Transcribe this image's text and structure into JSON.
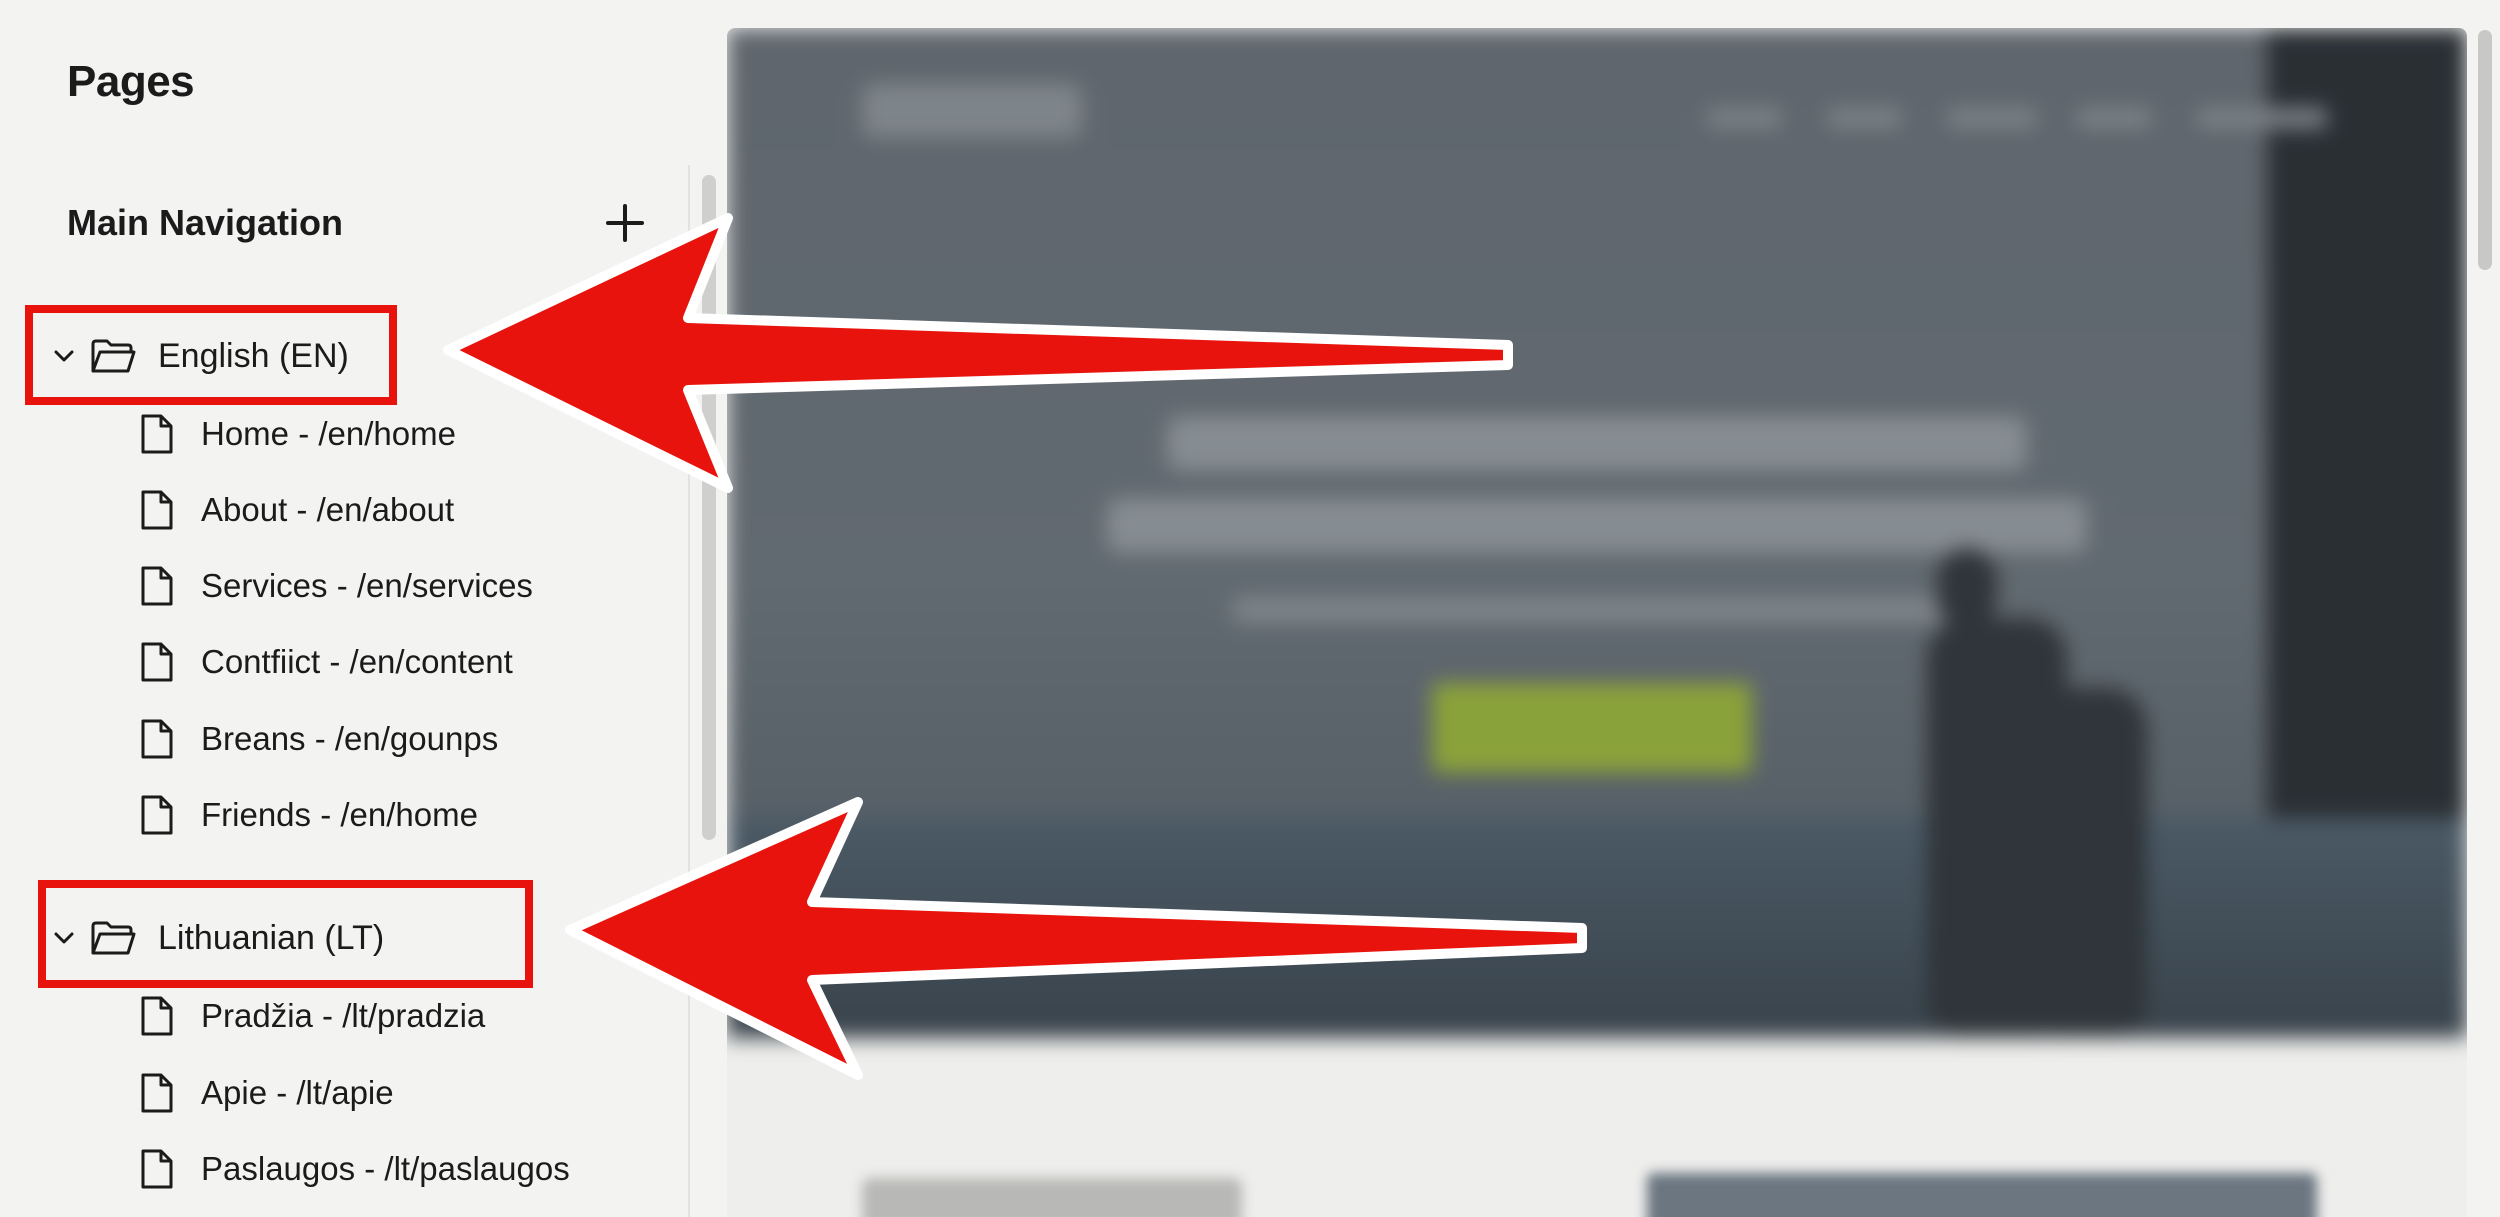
{
  "sidebar": {
    "title": "Pages",
    "section_title": "Main Navigation",
    "add_label": "+",
    "groups": [
      {
        "label": "English (EN)",
        "expanded": true,
        "highlighted": true,
        "pages": [
          "Home - /en/home",
          "About - /en/about",
          "Services - /en/services",
          "Contfiict - /en/content",
          "Breans - /en/gounps",
          "Friends - /en/home"
        ]
      },
      {
        "label": "Lithuanian (LT)",
        "expanded": true,
        "highlighted": true,
        "pages": [
          "Pradžia - /lt/pradzia",
          "Apie - /lt/apie",
          "Paslaugos - /lt/paslaugos"
        ]
      }
    ]
  },
  "preview": {
    "blurred": true,
    "cta_color": "#8aa23a"
  },
  "annotations": {
    "color": "#e8130c",
    "arrows": [
      {
        "points_to": "English (EN)"
      },
      {
        "points_to": "Lithuanian (LT)"
      }
    ]
  },
  "icons": {
    "chevron": "chevron-down-icon",
    "folder": "folder-open-icon",
    "page": "document-icon",
    "add": "plus-icon"
  }
}
